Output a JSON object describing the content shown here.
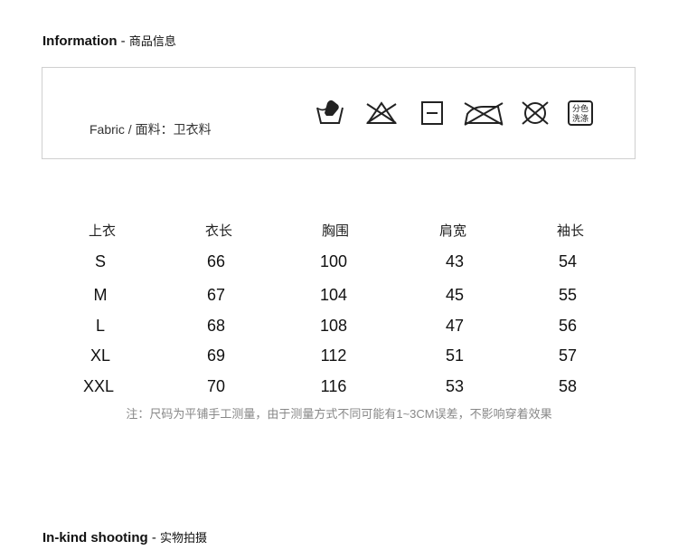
{
  "information": {
    "title": "Information",
    "separator": " - ",
    "subtitle": "商品信息"
  },
  "fabric": {
    "label": "Fabric / 面料：卫衣料"
  },
  "care_icons": [
    {
      "name": "hand-wash-icon"
    },
    {
      "name": "do-not-bleach-icon"
    },
    {
      "name": "dry-flat-icon"
    },
    {
      "name": "do-not-iron-icon"
    },
    {
      "name": "do-not-dry-clean-icon"
    },
    {
      "name": "wash-separately-icon",
      "text_top": "分色",
      "text_bottom": "洗涤"
    }
  ],
  "size_table": {
    "headers": [
      "上衣",
      "衣长",
      "胸围",
      "肩宽",
      "袖长"
    ],
    "rows": [
      [
        "S",
        "66",
        "100",
        "43",
        "54"
      ],
      [
        "M",
        "67",
        "104",
        "45",
        "55"
      ],
      [
        "L",
        "68",
        "108",
        "47",
        "56"
      ],
      [
        "XL",
        "69",
        "112",
        "51",
        "57"
      ],
      [
        "XXL",
        "70",
        "116",
        "53",
        "58"
      ]
    ]
  },
  "note": "注：尺码为平铺手工测量，由于测量方式不同可能有1~3CM误差，不影响穿着效果",
  "shooting": {
    "title": "In-kind shooting",
    "separator": " - ",
    "subtitle": "实物拍摄"
  }
}
